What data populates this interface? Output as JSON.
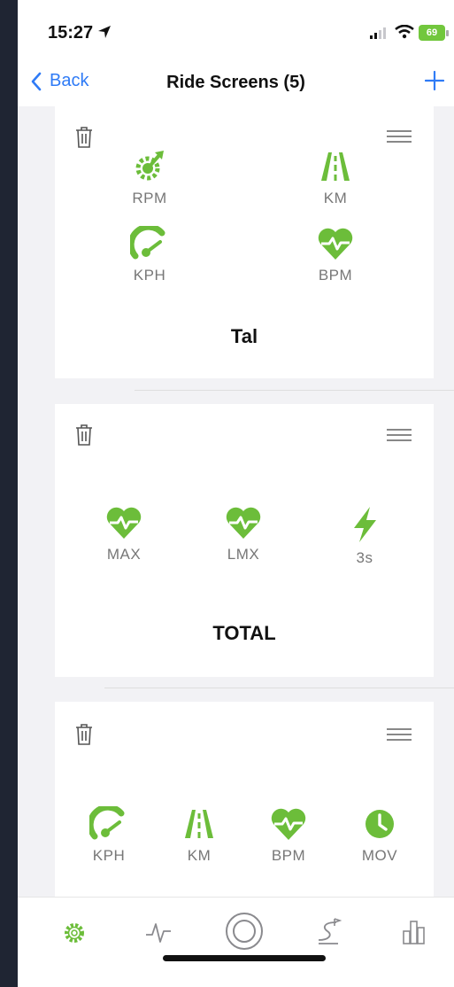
{
  "status": {
    "time": "15:27",
    "battery": "69"
  },
  "nav": {
    "back_label": "Back",
    "title": "Ride Screens (5)"
  },
  "screens": [
    {
      "name": "Tal",
      "metrics": [
        {
          "label": "RPM",
          "icon": "cadence-gear-icon"
        },
        {
          "label": "KM",
          "icon": "road-distance-icon"
        },
        {
          "label": "KPH",
          "icon": "speedometer-icon"
        },
        {
          "label": "BPM",
          "icon": "heart-rate-icon"
        }
      ]
    },
    {
      "name": "TOTAL",
      "metrics": [
        {
          "label": "MAX",
          "icon": "heart-rate-icon"
        },
        {
          "label": "LMX",
          "icon": "heart-rate-icon"
        },
        {
          "label": "3s",
          "icon": "lightning-power-icon"
        }
      ]
    },
    {
      "name": "",
      "metrics": [
        {
          "label": "KPH",
          "icon": "speedometer-icon"
        },
        {
          "label": "KM",
          "icon": "road-distance-icon"
        },
        {
          "label": "BPM",
          "icon": "heart-rate-icon"
        },
        {
          "label": "MOV",
          "icon": "clock-icon"
        }
      ]
    }
  ],
  "tabs": [
    {
      "icon": "gear-icon",
      "active": true
    },
    {
      "icon": "activity-pulse-icon",
      "active": false
    },
    {
      "icon": "record-circle-icon",
      "active": false
    },
    {
      "icon": "route-icon",
      "active": false
    },
    {
      "icon": "bar-chart-icon",
      "active": false
    }
  ],
  "colors": {
    "accent": "#6cbd3a",
    "link": "#2f7bf6",
    "inactive_icon": "#8a8a8e"
  }
}
